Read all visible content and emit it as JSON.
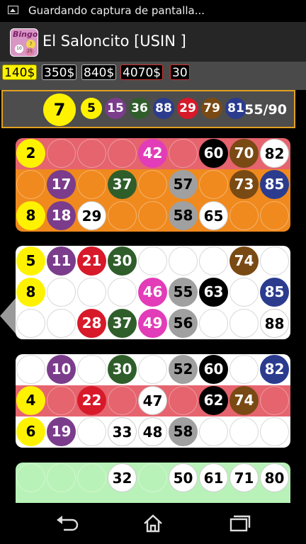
{
  "status_bar": {
    "text": "Guardando captura de pantalla..."
  },
  "title_bar": {
    "logo_text": "Bingo",
    "logo_balls": [
      "10",
      "7",
      "25"
    ],
    "title": "El Saloncito [USIN ]"
  },
  "prices": [
    {
      "label": "140$",
      "style": "active"
    },
    {
      "label": "350$",
      "style": "normal"
    },
    {
      "label": "840$",
      "style": "normal"
    },
    {
      "label": "4070$",
      "style": "red"
    },
    {
      "label": "30",
      "style": "red"
    }
  ],
  "draw": {
    "current": "7",
    "recent": [
      "5",
      "15",
      "36",
      "88",
      "29",
      "79",
      "81"
    ],
    "count": "55/90"
  },
  "colors": {
    "yellow": "#fff200",
    "purple": "#7b3c8c",
    "red": "#d7192a",
    "green": "#2f5e2a",
    "magenta": "#e23cb8",
    "gray": "#a0a0a0",
    "black": "#000000",
    "brown": "#7a4a14",
    "blue": "#2b3c8f",
    "white": "#ffffff",
    "pink_row": "#e5646e",
    "orange_row": "#f08a1e",
    "green_row": "#b9f2b9",
    "plain_row": "#ffffff"
  },
  "cards": [
    {
      "rows": [
        {
          "bg": "pink_row",
          "cells": [
            [
              "2",
              "yellow"
            ],
            [
              "",
              ""
            ],
            [
              "",
              ""
            ],
            [
              "",
              ""
            ],
            [
              "42",
              "magenta"
            ],
            [
              "",
              ""
            ],
            [
              "60",
              "black"
            ],
            [
              "70",
              "brown"
            ],
            [
              "82",
              "white"
            ]
          ]
        },
        {
          "bg": "orange_row",
          "cells": [
            [
              "",
              ""
            ],
            [
              "17",
              "purple"
            ],
            [
              "",
              ""
            ],
            [
              "37",
              "green"
            ],
            [
              "",
              ""
            ],
            [
              "57",
              "gray"
            ],
            [
              "",
              ""
            ],
            [
              "73",
              "brown"
            ],
            [
              "85",
              "blue"
            ]
          ]
        },
        {
          "bg": "orange_row",
          "cells": [
            [
              "8",
              "yellow"
            ],
            [
              "18",
              "purple"
            ],
            [
              "29",
              "white"
            ],
            [
              "",
              ""
            ],
            [
              "",
              ""
            ],
            [
              "58",
              "gray"
            ],
            [
              "65",
              "white"
            ],
            [
              "",
              ""
            ],
            [
              "",
              ""
            ]
          ]
        }
      ]
    },
    {
      "rows": [
        {
          "bg": "plain_row",
          "cells": [
            [
              "5",
              "yellow"
            ],
            [
              "11",
              "purple"
            ],
            [
              "21",
              "red"
            ],
            [
              "30",
              "green"
            ],
            [
              "",
              ""
            ],
            [
              "",
              ""
            ],
            [
              "",
              ""
            ],
            [
              "74",
              "brown"
            ],
            [
              "",
              ""
            ]
          ]
        },
        {
          "bg": "plain_row",
          "cells": [
            [
              "8",
              "yellow"
            ],
            [
              "",
              ""
            ],
            [
              "",
              ""
            ],
            [
              "",
              ""
            ],
            [
              "46",
              "magenta"
            ],
            [
              "55",
              "gray"
            ],
            [
              "63",
              "black"
            ],
            [
              "",
              ""
            ],
            [
              "85",
              "blue"
            ]
          ]
        },
        {
          "bg": "plain_row",
          "cells": [
            [
              "",
              ""
            ],
            [
              "",
              ""
            ],
            [
              "28",
              "red"
            ],
            [
              "37",
              "green"
            ],
            [
              "49",
              "magenta"
            ],
            [
              "56",
              "gray"
            ],
            [
              "",
              ""
            ],
            [
              "",
              ""
            ],
            [
              "88",
              "white"
            ]
          ]
        }
      ]
    },
    {
      "rows": [
        {
          "bg": "plain_row",
          "cells": [
            [
              "",
              ""
            ],
            [
              "10",
              "purple"
            ],
            [
              "",
              ""
            ],
            [
              "30",
              "green"
            ],
            [
              "",
              ""
            ],
            [
              "52",
              "gray"
            ],
            [
              "60",
              "black"
            ],
            [
              "",
              ""
            ],
            [
              "82",
              "blue"
            ]
          ]
        },
        {
          "bg": "pink_row",
          "cells": [
            [
              "4",
              "yellow"
            ],
            [
              "",
              ""
            ],
            [
              "22",
              "red"
            ],
            [
              "",
              ""
            ],
            [
              "47",
              "white"
            ],
            [
              "",
              ""
            ],
            [
              "62",
              "black"
            ],
            [
              "74",
              "brown"
            ],
            [
              "",
              ""
            ]
          ]
        },
        {
          "bg": "plain_row",
          "cells": [
            [
              "6",
              "yellow"
            ],
            [
              "19",
              "purple"
            ],
            [
              "",
              ""
            ],
            [
              "33",
              "white"
            ],
            [
              "48",
              "white"
            ],
            [
              "58",
              "gray"
            ],
            [
              "",
              ""
            ],
            [
              "",
              ""
            ],
            [
              "",
              ""
            ]
          ]
        }
      ]
    },
    {
      "rows": [
        {
          "bg": "green_row",
          "cells": [
            [
              "",
              ""
            ],
            [
              "",
              ""
            ],
            [
              "",
              ""
            ],
            [
              "32",
              "white"
            ],
            [
              "",
              ""
            ],
            [
              "50",
              "white"
            ],
            [
              "61",
              "white"
            ],
            [
              "71",
              "white"
            ],
            [
              "80",
              "white"
            ]
          ]
        }
      ]
    }
  ],
  "nav": {
    "back": "back-icon",
    "home": "home-icon",
    "recent": "recent-apps-icon"
  }
}
